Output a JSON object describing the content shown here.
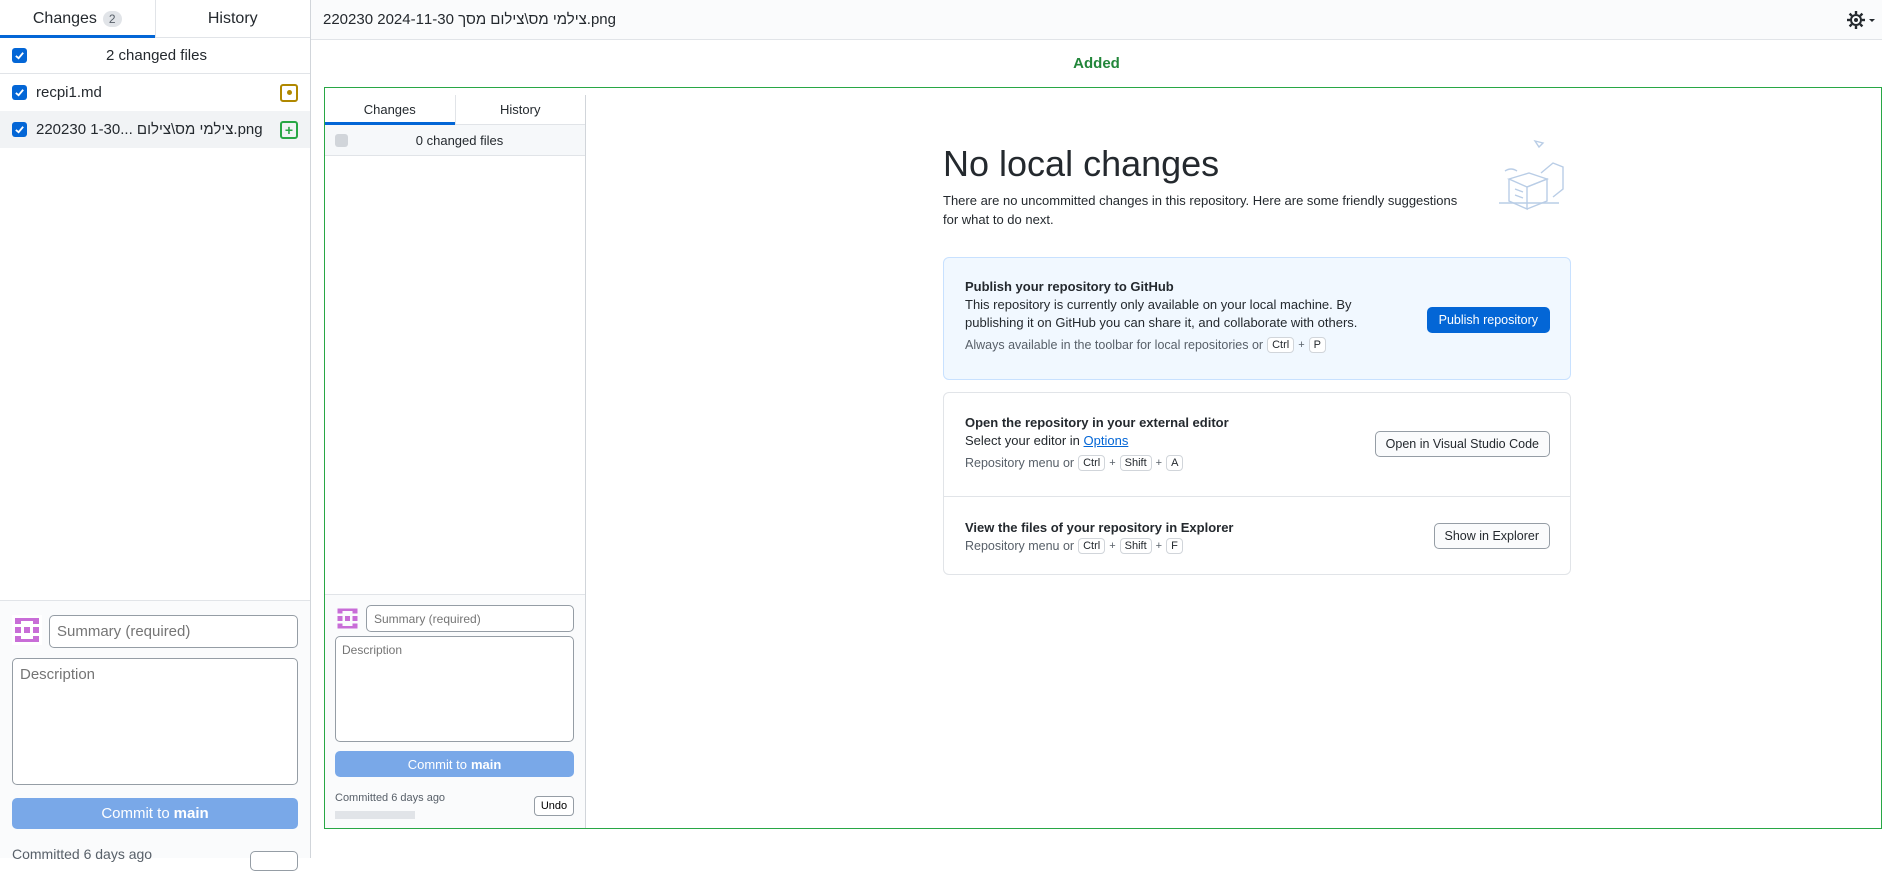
{
  "sidebar": {
    "tabs": [
      {
        "label": "Changes",
        "count": "2"
      },
      {
        "label": "History"
      }
    ],
    "changed_files_label": "2 changed files",
    "files": [
      {
        "name": "recpi1.md",
        "status": "modified"
      },
      {
        "name": "220230 1-30... צילמי מס\\צילום.png",
        "status": "added"
      }
    ],
    "commit": {
      "summary_placeholder": "Summary (required)",
      "description_placeholder": "Description",
      "button_prefix": "Commit to",
      "branch": "main"
    },
    "committed_label": "Committed 6 days ago"
  },
  "main": {
    "file_path": "220230 2024-11-30 צילמי מס\\צילום מסך.png",
    "diff_status": "Added",
    "diff_status_color": "#22863a"
  },
  "screenshot": {
    "tabs": [
      {
        "label": "Changes"
      },
      {
        "label": "History"
      }
    ],
    "changed_files_label": "0 changed files",
    "commit": {
      "summary_placeholder": "Summary (required)",
      "description_placeholder": "Description",
      "button_prefix": "Commit to",
      "branch": "main"
    },
    "committed_label": "Committed 6 days ago",
    "undo_label": "Undo",
    "blank": {
      "title": "No local changes",
      "subtitle": "There are no uncommitted changes in this repository. Here are some friendly suggestions for what to do next.",
      "publish": {
        "title": "Publish your repository to GitHub",
        "text": "This repository is currently only available on your local machine. By publishing it on GitHub you can share it, and collaborate with others.",
        "hint": "Always available in the toolbar for local repositories or",
        "keys": [
          "Ctrl",
          "P"
        ],
        "button": "Publish repository"
      },
      "editor": {
        "title": "Open the repository in your external editor",
        "text_prefix": "Select your editor in",
        "link": "Options",
        "hint": "Repository menu or",
        "keys": [
          "Ctrl",
          "Shift",
          "A"
        ],
        "button": "Open in Visual Studio Code"
      },
      "explorer": {
        "title": "View the files of your repository in Explorer",
        "hint": "Repository menu or",
        "keys": [
          "Ctrl",
          "Shift",
          "F"
        ],
        "button": "Show in Explorer"
      }
    }
  },
  "colors": {
    "accent": "#0366d6",
    "added": "#28a745",
    "modified": "#b08800",
    "commit_button": "#79a8e8"
  }
}
